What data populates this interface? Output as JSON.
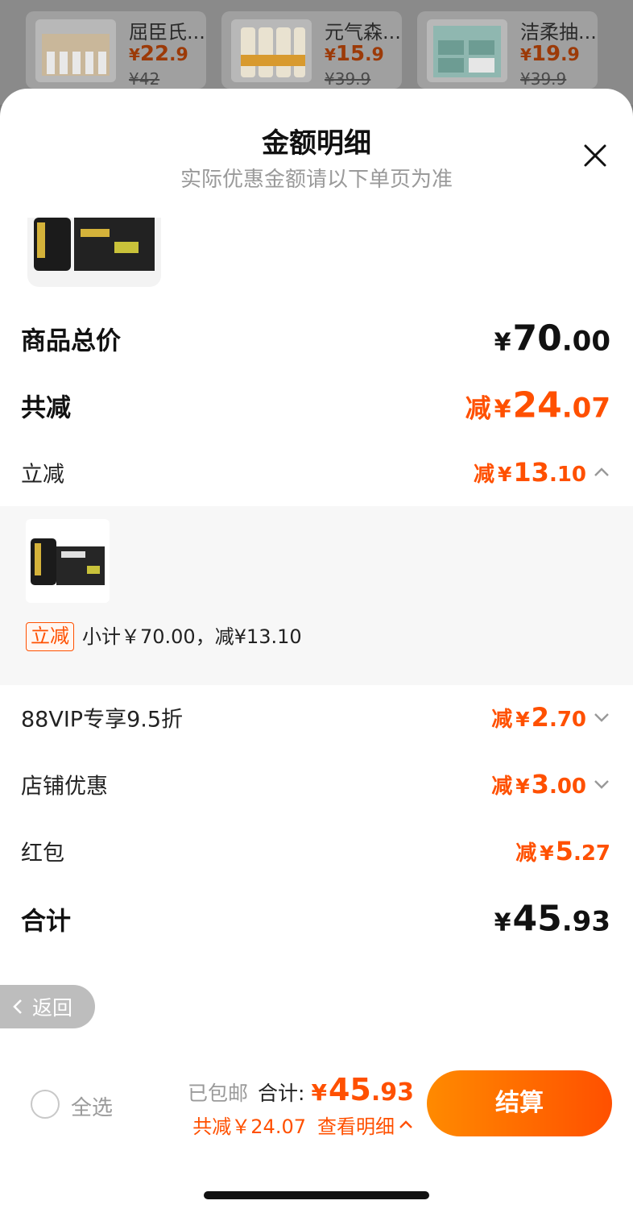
{
  "background_products": [
    {
      "name": "屈臣氏...",
      "price_int": "22",
      "price_dec": ".9",
      "original_price": "¥42"
    },
    {
      "name": "元气森...",
      "price_int": "15",
      "price_dec": ".9",
      "original_price": "¥39.9"
    },
    {
      "name": "洁柔抽...",
      "price_int": "19",
      "price_dec": ".9",
      "original_price": "¥39.9"
    }
  ],
  "currency": "¥",
  "sheet": {
    "title": "金额明细",
    "subtitle": "实际优惠金额请以下单页为准"
  },
  "summary_rows": {
    "goods_total": {
      "label": "商品总价",
      "int": "70",
      "dec": ".00"
    },
    "total_discount": {
      "label": "共减",
      "prefix": "减",
      "int": "24",
      "dec": ".07"
    },
    "instant_discount": {
      "label": "立减",
      "prefix": "减",
      "int": "13",
      "dec": ".10"
    },
    "vip_discount": {
      "label": "88VIP专享9.5折",
      "prefix": "减",
      "int": "2",
      "dec": ".70"
    },
    "store_discount": {
      "label": "店铺优惠",
      "prefix": "减",
      "int": "3",
      "dec": ".00"
    },
    "red_packet": {
      "label": "红包",
      "prefix": "减",
      "int": "5",
      "dec": ".27"
    },
    "total": {
      "label": "合计",
      "int": "45",
      "dec": ".93"
    }
  },
  "instant_detail": {
    "tag": "立减",
    "text": "小计￥70.00，减¥13.10"
  },
  "back_label": "返回",
  "bottom_bar": {
    "select_all": "全选",
    "free_shipping": "已包邮",
    "total_label": "合计:",
    "total_int": "45",
    "total_dec": ".93",
    "discount_text": "共减￥24.07",
    "view_detail": "查看明细",
    "checkout": "结算"
  },
  "colors": {
    "accent": "#ff5000",
    "checkout_gradient_start": "#ff8a00",
    "checkout_gradient_end": "#ff5000"
  }
}
